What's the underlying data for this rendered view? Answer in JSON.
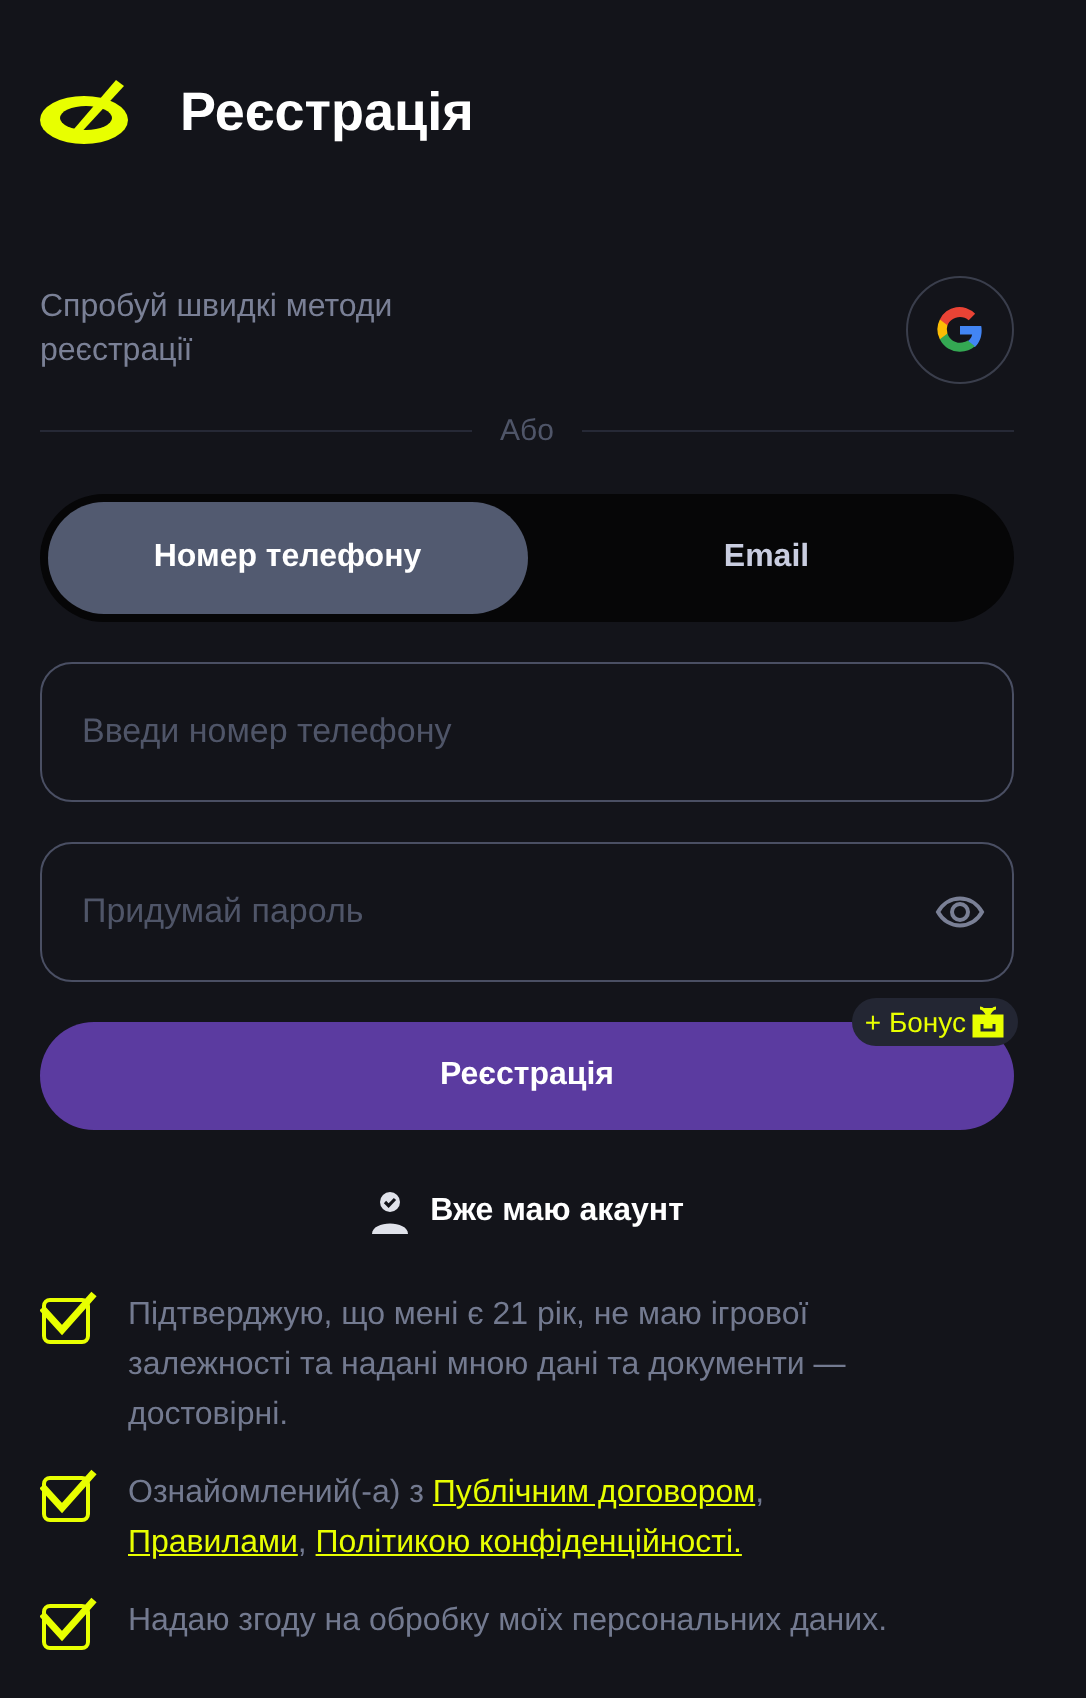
{
  "header": {
    "title": "Реєстрація"
  },
  "quick": {
    "text": "Спробуй швидкі методи реєстрації"
  },
  "divider": "Або",
  "tabs": [
    {
      "label": "Номер телефону",
      "selected": true
    },
    {
      "label": "Email",
      "selected": false
    }
  ],
  "fields": [
    {
      "placeholder": "Введи номер телефону",
      "kind": "text"
    },
    {
      "placeholder": "Придумай пароль",
      "kind": "password"
    }
  ],
  "submit": {
    "label": "Реєстрація",
    "badge": "+ Бонус"
  },
  "login_link": "Вже маю акаунт",
  "consents": [
    {
      "checked": true,
      "parts": [
        {
          "text": "Підтверджую, що мені є 21 рік, не маю ігрової залежності та надані мною дані та документи — достовірні.",
          "link": false
        }
      ]
    },
    {
      "checked": true,
      "parts": [
        {
          "text": "Ознайомлений(-а) з ",
          "link": false
        },
        {
          "text": "Публічним договором",
          "link": true
        },
        {
          "text": ", ",
          "link": false
        },
        {
          "text": "Правилами",
          "link": true
        },
        {
          "text": ", ",
          "link": false
        },
        {
          "text": "Політикою конфіденційності.",
          "link": true
        }
      ]
    },
    {
      "checked": true,
      "parts": [
        {
          "text": "Надаю згоду на обробку моїх персональних даних.",
          "link": false
        }
      ]
    }
  ]
}
